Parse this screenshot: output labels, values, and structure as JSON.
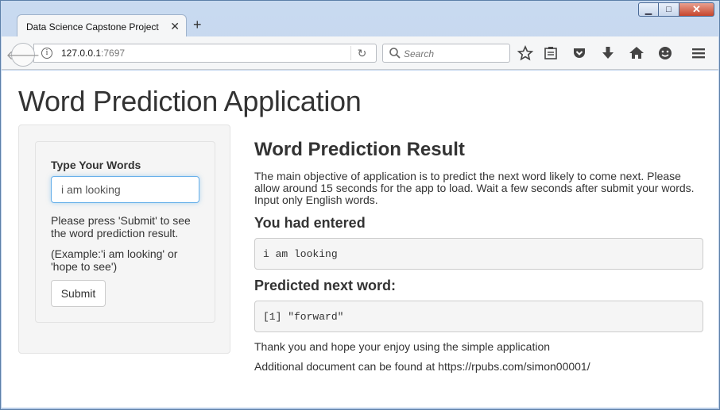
{
  "browser": {
    "tab_title": "Data Science Capstone Project",
    "url_host": "127.0.0.1",
    "url_port": ":7697",
    "search_placeholder": "Search"
  },
  "app": {
    "title": "Word Prediction Application",
    "sidebar": {
      "input_label": "Type Your Words",
      "input_value": "i am looking",
      "help_text": "Please press 'Submit' to see the word prediction result.",
      "example_text": "(Example:'i am looking' or 'hope to see')",
      "submit_label": "Submit"
    },
    "main": {
      "result_title": "Word Prediction Result",
      "description": "The main objective of application is to predict the next word likely to come next. Please allow around 15 seconds for the app to load. Wait a few seconds after submit your words. Input only English words.",
      "entered_heading": "You had entered",
      "entered_value": "i am looking",
      "predicted_heading": "Predicted next word:",
      "predicted_value": "[1] \"forward\"",
      "thanks_text": "Thank you and hope your enjoy using the simple application",
      "additional_text": "Additional document can be found at https://rpubs.com/simon00001/"
    }
  }
}
